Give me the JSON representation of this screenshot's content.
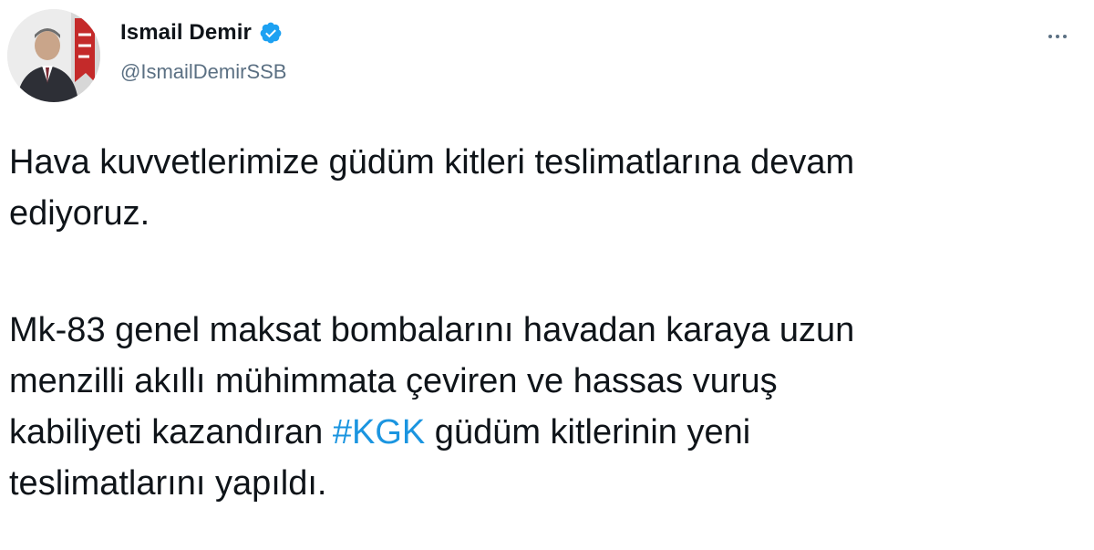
{
  "author": {
    "display_name": "Ismail Demir",
    "handle": "@IsmailDemirSSB",
    "verified": true
  },
  "icons": {
    "verified": "verified-badge-icon",
    "more": "more-options-icon",
    "avatar": "profile-photo"
  },
  "colors": {
    "link": "#1b95e0",
    "text": "#0f1419",
    "secondary": "#5b7083",
    "verified": "#1da1f2"
  },
  "tweet": {
    "paragraph_1_line_1": "Hava kuvvetlerimize güdüm kitleri teslimatlarına devam",
    "paragraph_1_line_2": "ediyoruz.",
    "paragraph_2_line_1": "Mk-83 genel maksat bombalarını havadan karaya uzun",
    "paragraph_2_line_2": "menzilli akıllı mühimmata çeviren ve hassas vuruş",
    "paragraph_2_line_3_before": "kabiliyeti kazandıran ",
    "hashtag": "#KGK",
    "paragraph_2_line_3_after": " güdüm kitlerinin yeni",
    "paragraph_2_line_4": "teslimatlarını yapıldı."
  }
}
